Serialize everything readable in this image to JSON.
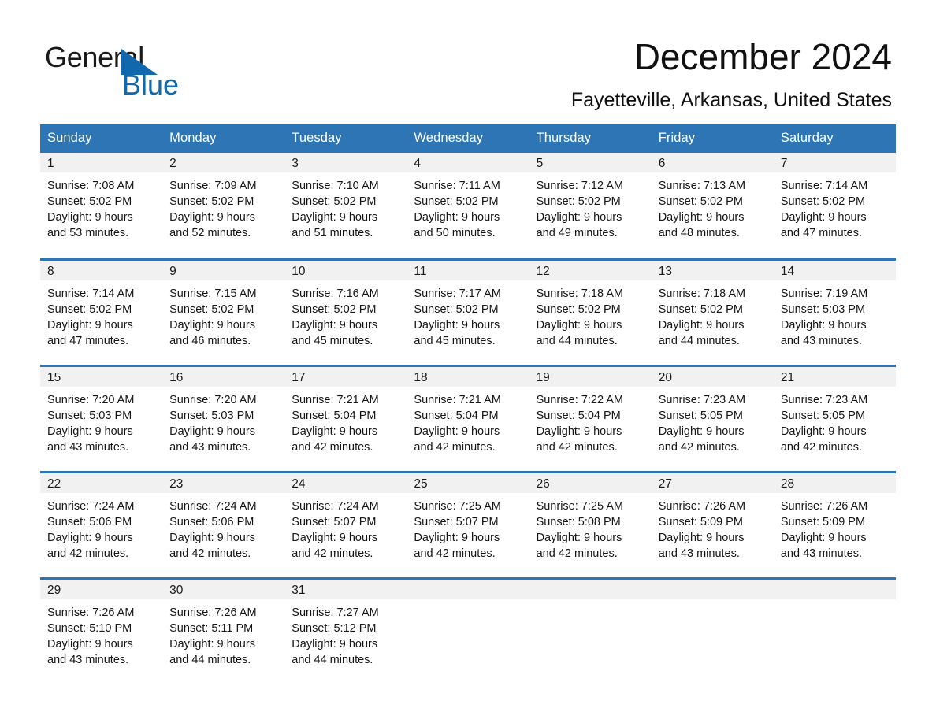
{
  "brand": {
    "name_part1": "General",
    "name_part2": "Blue",
    "accent_color": "#1168ad",
    "triangle_icon": "triangle-icon"
  },
  "header": {
    "month_title": "December 2024",
    "location": "Fayetteville, Arkansas, United States"
  },
  "theme": {
    "header_blue": "#2e75b6",
    "daynum_band_gray": "#f1f1f1",
    "text_black": "#161616"
  },
  "calendar": {
    "weekday_headers": [
      "Sunday",
      "Monday",
      "Tuesday",
      "Wednesday",
      "Thursday",
      "Friday",
      "Saturday"
    ],
    "labels": {
      "sunrise_prefix": "Sunrise:",
      "sunset_prefix": "Sunset:",
      "daylight_prefix": "Daylight:"
    },
    "weeks": [
      [
        {
          "day": "1",
          "sunrise": "Sunrise: 7:08 AM",
          "sunset": "Sunset: 5:02 PM",
          "daylight_line1": "Daylight: 9 hours",
          "daylight_line2": "and 53 minutes."
        },
        {
          "day": "2",
          "sunrise": "Sunrise: 7:09 AM",
          "sunset": "Sunset: 5:02 PM",
          "daylight_line1": "Daylight: 9 hours",
          "daylight_line2": "and 52 minutes."
        },
        {
          "day": "3",
          "sunrise": "Sunrise: 7:10 AM",
          "sunset": "Sunset: 5:02 PM",
          "daylight_line1": "Daylight: 9 hours",
          "daylight_line2": "and 51 minutes."
        },
        {
          "day": "4",
          "sunrise": "Sunrise: 7:11 AM",
          "sunset": "Sunset: 5:02 PM",
          "daylight_line1": "Daylight: 9 hours",
          "daylight_line2": "and 50 minutes."
        },
        {
          "day": "5",
          "sunrise": "Sunrise: 7:12 AM",
          "sunset": "Sunset: 5:02 PM",
          "daylight_line1": "Daylight: 9 hours",
          "daylight_line2": "and 49 minutes."
        },
        {
          "day": "6",
          "sunrise": "Sunrise: 7:13 AM",
          "sunset": "Sunset: 5:02 PM",
          "daylight_line1": "Daylight: 9 hours",
          "daylight_line2": "and 48 minutes."
        },
        {
          "day": "7",
          "sunrise": "Sunrise: 7:14 AM",
          "sunset": "Sunset: 5:02 PM",
          "daylight_line1": "Daylight: 9 hours",
          "daylight_line2": "and 47 minutes."
        }
      ],
      [
        {
          "day": "8",
          "sunrise": "Sunrise: 7:14 AM",
          "sunset": "Sunset: 5:02 PM",
          "daylight_line1": "Daylight: 9 hours",
          "daylight_line2": "and 47 minutes."
        },
        {
          "day": "9",
          "sunrise": "Sunrise: 7:15 AM",
          "sunset": "Sunset: 5:02 PM",
          "daylight_line1": "Daylight: 9 hours",
          "daylight_line2": "and 46 minutes."
        },
        {
          "day": "10",
          "sunrise": "Sunrise: 7:16 AM",
          "sunset": "Sunset: 5:02 PM",
          "daylight_line1": "Daylight: 9 hours",
          "daylight_line2": "and 45 minutes."
        },
        {
          "day": "11",
          "sunrise": "Sunrise: 7:17 AM",
          "sunset": "Sunset: 5:02 PM",
          "daylight_line1": "Daylight: 9 hours",
          "daylight_line2": "and 45 minutes."
        },
        {
          "day": "12",
          "sunrise": "Sunrise: 7:18 AM",
          "sunset": "Sunset: 5:02 PM",
          "daylight_line1": "Daylight: 9 hours",
          "daylight_line2": "and 44 minutes."
        },
        {
          "day": "13",
          "sunrise": "Sunrise: 7:18 AM",
          "sunset": "Sunset: 5:02 PM",
          "daylight_line1": "Daylight: 9 hours",
          "daylight_line2": "and 44 minutes."
        },
        {
          "day": "14",
          "sunrise": "Sunrise: 7:19 AM",
          "sunset": "Sunset: 5:03 PM",
          "daylight_line1": "Daylight: 9 hours",
          "daylight_line2": "and 43 minutes."
        }
      ],
      [
        {
          "day": "15",
          "sunrise": "Sunrise: 7:20 AM",
          "sunset": "Sunset: 5:03 PM",
          "daylight_line1": "Daylight: 9 hours",
          "daylight_line2": "and 43 minutes."
        },
        {
          "day": "16",
          "sunrise": "Sunrise: 7:20 AM",
          "sunset": "Sunset: 5:03 PM",
          "daylight_line1": "Daylight: 9 hours",
          "daylight_line2": "and 43 minutes."
        },
        {
          "day": "17",
          "sunrise": "Sunrise: 7:21 AM",
          "sunset": "Sunset: 5:04 PM",
          "daylight_line1": "Daylight: 9 hours",
          "daylight_line2": "and 42 minutes."
        },
        {
          "day": "18",
          "sunrise": "Sunrise: 7:21 AM",
          "sunset": "Sunset: 5:04 PM",
          "daylight_line1": "Daylight: 9 hours",
          "daylight_line2": "and 42 minutes."
        },
        {
          "day": "19",
          "sunrise": "Sunrise: 7:22 AM",
          "sunset": "Sunset: 5:04 PM",
          "daylight_line1": "Daylight: 9 hours",
          "daylight_line2": "and 42 minutes."
        },
        {
          "day": "20",
          "sunrise": "Sunrise: 7:23 AM",
          "sunset": "Sunset: 5:05 PM",
          "daylight_line1": "Daylight: 9 hours",
          "daylight_line2": "and 42 minutes."
        },
        {
          "day": "21",
          "sunrise": "Sunrise: 7:23 AM",
          "sunset": "Sunset: 5:05 PM",
          "daylight_line1": "Daylight: 9 hours",
          "daylight_line2": "and 42 minutes."
        }
      ],
      [
        {
          "day": "22",
          "sunrise": "Sunrise: 7:24 AM",
          "sunset": "Sunset: 5:06 PM",
          "daylight_line1": "Daylight: 9 hours",
          "daylight_line2": "and 42 minutes."
        },
        {
          "day": "23",
          "sunrise": "Sunrise: 7:24 AM",
          "sunset": "Sunset: 5:06 PM",
          "daylight_line1": "Daylight: 9 hours",
          "daylight_line2": "and 42 minutes."
        },
        {
          "day": "24",
          "sunrise": "Sunrise: 7:24 AM",
          "sunset": "Sunset: 5:07 PM",
          "daylight_line1": "Daylight: 9 hours",
          "daylight_line2": "and 42 minutes."
        },
        {
          "day": "25",
          "sunrise": "Sunrise: 7:25 AM",
          "sunset": "Sunset: 5:07 PM",
          "daylight_line1": "Daylight: 9 hours",
          "daylight_line2": "and 42 minutes."
        },
        {
          "day": "26",
          "sunrise": "Sunrise: 7:25 AM",
          "sunset": "Sunset: 5:08 PM",
          "daylight_line1": "Daylight: 9 hours",
          "daylight_line2": "and 42 minutes."
        },
        {
          "day": "27",
          "sunrise": "Sunrise: 7:26 AM",
          "sunset": "Sunset: 5:09 PM",
          "daylight_line1": "Daylight: 9 hours",
          "daylight_line2": "and 43 minutes."
        },
        {
          "day": "28",
          "sunrise": "Sunrise: 7:26 AM",
          "sunset": "Sunset: 5:09 PM",
          "daylight_line1": "Daylight: 9 hours",
          "daylight_line2": "and 43 minutes."
        }
      ],
      [
        {
          "day": "29",
          "sunrise": "Sunrise: 7:26 AM",
          "sunset": "Sunset: 5:10 PM",
          "daylight_line1": "Daylight: 9 hours",
          "daylight_line2": "and 43 minutes."
        },
        {
          "day": "30",
          "sunrise": "Sunrise: 7:26 AM",
          "sunset": "Sunset: 5:11 PM",
          "daylight_line1": "Daylight: 9 hours",
          "daylight_line2": "and 44 minutes."
        },
        {
          "day": "31",
          "sunrise": "Sunrise: 7:27 AM",
          "sunset": "Sunset: 5:12 PM",
          "daylight_line1": "Daylight: 9 hours",
          "daylight_line2": "and 44 minutes."
        },
        {
          "day": "",
          "sunrise": "",
          "sunset": "",
          "daylight_line1": "",
          "daylight_line2": ""
        },
        {
          "day": "",
          "sunrise": "",
          "sunset": "",
          "daylight_line1": "",
          "daylight_line2": ""
        },
        {
          "day": "",
          "sunrise": "",
          "sunset": "",
          "daylight_line1": "",
          "daylight_line2": ""
        },
        {
          "day": "",
          "sunrise": "",
          "sunset": "",
          "daylight_line1": "",
          "daylight_line2": ""
        }
      ]
    ]
  }
}
